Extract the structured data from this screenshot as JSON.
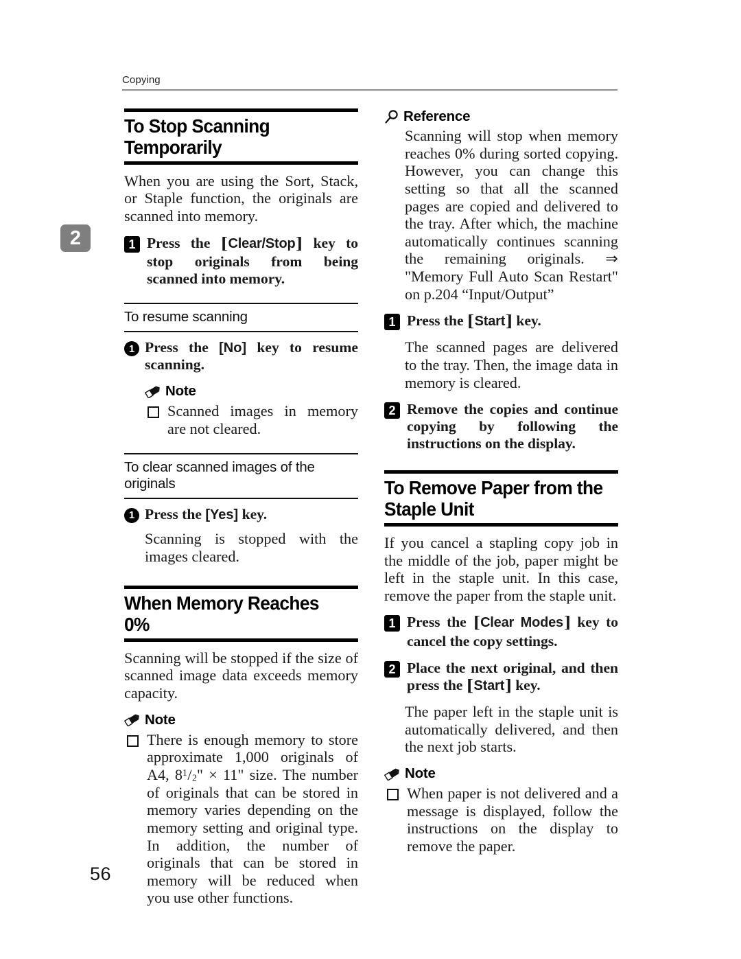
{
  "page": {
    "running_head": "Copying",
    "chapter_tab": "2",
    "folio": "56"
  },
  "left_column": {
    "section1": {
      "title": "To Stop Scanning Temporarily",
      "intro": "When you are using the Sort, Stack, or Staple function, the originals are scanned into memory.",
      "step1": {
        "marker": "1",
        "text_before_key": "Press the ",
        "key": "Clear/Stop",
        "text_after_key": " key to stop originals from being scanned into memory."
      },
      "subsection1": {
        "title": "To resume scanning",
        "substep1": {
          "marker": "1",
          "text_before_key": "Press the ",
          "key": "No",
          "text_after_key": " key to resume scanning."
        },
        "note": {
          "label": "Note",
          "items": [
            "Scanned images in memory are not cleared."
          ]
        }
      },
      "subsection2": {
        "title": "To clear scanned images of the originals",
        "substep1": {
          "marker": "1",
          "text_before_key": "Press the ",
          "key": "Yes",
          "text_after_key": " key."
        },
        "result": "Scanning is stopped with the images cleared."
      }
    },
    "section2": {
      "title": "When Memory Reaches 0%",
      "intro": "Scanning will be stopped if the size of scanned image data exceeds memory capacity.",
      "note": {
        "label": "Note",
        "item_part1": "There is enough memory to store approximate 1,000 originals of A4, 8",
        "fraction_numerator": "1",
        "fraction_denominator": "2",
        "item_part2": "\" × 11\" size. The number of originals that can be stored in memory varies depending on the memory setting and original type. In addition, the number of originals that can be stored in memory will be reduced when you use other functions."
      }
    }
  },
  "right_column": {
    "reference": {
      "label": "Reference",
      "body": "Scanning will stop when memory reaches 0% during sorted copying. However, you can change this setting so that all the scanned pages are copied and delivered to the tray. After which, the machine automatically continues scanning the remaining originals. ⇒ \"Memory Full Auto Scan Restart\" on p.204 “Input/Output”"
    },
    "step1": {
      "marker": "1",
      "text_before_key": "Press the ",
      "key": "Start",
      "text_after_key": " key.",
      "result": "The scanned pages are delivered to the tray. Then, the image data in memory is cleared."
    },
    "step2": {
      "marker": "2",
      "text": "Remove the copies and continue copying by following the instructions on the display."
    },
    "section": {
      "title_line1": "To Remove Paper from the",
      "title_line2": "Staple Unit",
      "intro": "If you cancel a stapling copy job in the middle of the job, paper might be left in the staple unit. In this case, remove the paper from the staple unit.",
      "step1": {
        "marker": "1",
        "text_before_key": "Press the ",
        "key": "Clear Modes",
        "text_after_key": " key to cancel the copy settings."
      },
      "step2": {
        "marker": "2",
        "text_before_key": "Place the next original, and then press the ",
        "key": "Start",
        "text_after_key": " key.",
        "result": "The paper left in the staple unit is automatically delivered, and then the next job starts."
      },
      "note": {
        "label": "Note",
        "items": [
          "When paper is not delivered and a message is displayed, follow the instructions on the display to remove the paper."
        ]
      }
    }
  }
}
